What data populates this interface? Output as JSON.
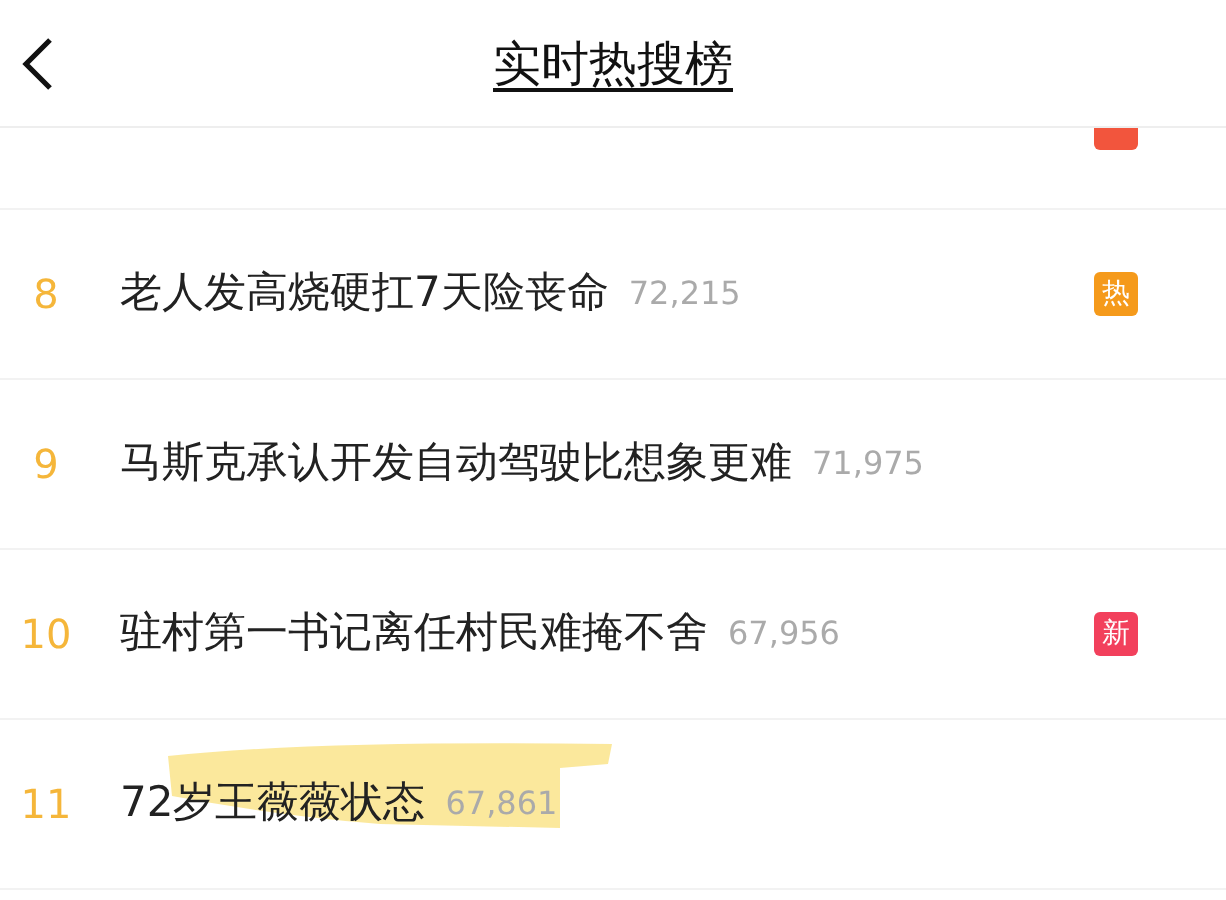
{
  "header": {
    "title": "实时热搜榜"
  },
  "rows": [
    {
      "kind": "cut",
      "badge": {
        "color": "#f2553d"
      }
    },
    {
      "rank": "8",
      "title": "老人发高烧硬扛7天险丧命",
      "count": "72,215",
      "badge": {
        "label": "热",
        "color": "#f59a1b"
      },
      "highlighted": false
    },
    {
      "rank": "9",
      "title": "马斯克承认开发自动驾驶比想象更难",
      "count": "71,975",
      "highlighted": false
    },
    {
      "rank": "10",
      "title": "驻村第一书记离任村民难掩不舍",
      "count": "67,956",
      "badge": {
        "label": "新",
        "color": "#f2405c"
      },
      "highlighted": false
    },
    {
      "rank": "11",
      "title": "72岁王薇薇状态",
      "count": "67,861",
      "highlighted": true
    }
  ]
}
